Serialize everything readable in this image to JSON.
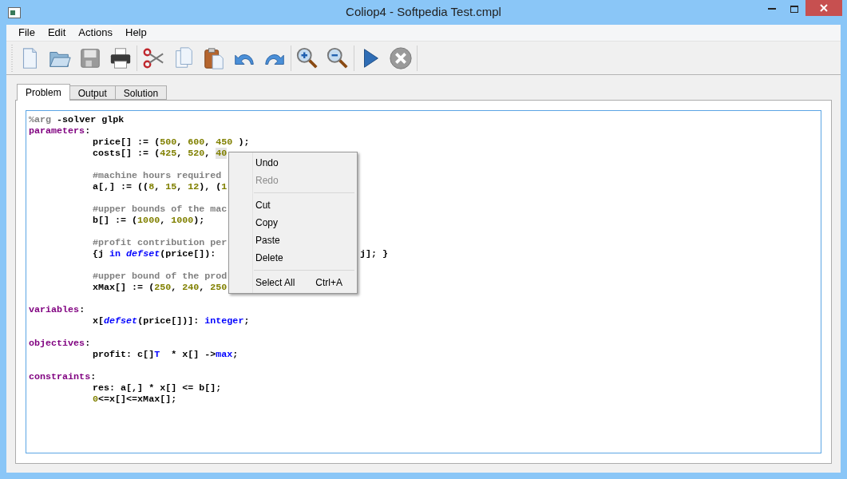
{
  "window": {
    "title": "Coliop4 - Softpedia Test.cmpl"
  },
  "menu_bar": [
    "File",
    "Edit",
    "Actions",
    "Help"
  ],
  "tabs": [
    {
      "label": "Problem",
      "selected": true
    },
    {
      "label": "Output",
      "selected": false
    },
    {
      "label": "Solution",
      "selected": false
    }
  ],
  "editor": {
    "lines": [
      {
        "kind": "code",
        "indented": false,
        "tokens": [
          {
            "text": "%arg",
            "kind": "comment"
          },
          {
            "text": " -solver glpk",
            "kind": "plain"
          }
        ]
      },
      {
        "kind": "code",
        "indented": false,
        "tokens": [
          {
            "text": "parameters",
            "kind": "keyword"
          },
          {
            "text": ":",
            "kind": "plain"
          }
        ]
      },
      {
        "kind": "code",
        "indented": true,
        "tokens": [
          {
            "text": "price[] := (",
            "kind": "plain"
          },
          {
            "text": "500",
            "kind": "number"
          },
          {
            "text": ", ",
            "kind": "plain"
          },
          {
            "text": "600",
            "kind": "number"
          },
          {
            "text": ", ",
            "kind": "plain"
          },
          {
            "text": "450",
            "kind": "number"
          },
          {
            "text": " );",
            "kind": "plain"
          }
        ]
      },
      {
        "kind": "code",
        "indented": true,
        "tokens": [
          {
            "text": "costs[] := (",
            "kind": "plain"
          },
          {
            "text": "425",
            "kind": "number"
          },
          {
            "text": ", ",
            "kind": "plain"
          },
          {
            "text": "520",
            "kind": "number"
          },
          {
            "text": ", ",
            "kind": "plain"
          },
          {
            "text": "40",
            "kind": "highlighted_number"
          }
        ]
      },
      {
        "kind": "blank"
      },
      {
        "kind": "code",
        "indented": true,
        "tokens": [
          {
            "text": "#machine hours required",
            "kind": "comment"
          }
        ]
      },
      {
        "kind": "code",
        "indented": true,
        "tokens": [
          {
            "text": "a[,] := ((",
            "kind": "plain"
          },
          {
            "text": "8",
            "kind": "number"
          },
          {
            "text": ", ",
            "kind": "plain"
          },
          {
            "text": "15",
            "kind": "number"
          },
          {
            "text": ", ",
            "kind": "plain"
          },
          {
            "text": "12",
            "kind": "number"
          },
          {
            "text": "), (",
            "kind": "plain"
          },
          {
            "text": "1",
            "kind": "number"
          }
        ]
      },
      {
        "kind": "blank"
      },
      {
        "kind": "code",
        "indented": true,
        "tokens": [
          {
            "text": "#upper bounds of the mac",
            "kind": "comment"
          }
        ]
      },
      {
        "kind": "code",
        "indented": true,
        "tokens": [
          {
            "text": "b[] := (",
            "kind": "plain"
          },
          {
            "text": "1000",
            "kind": "number"
          },
          {
            "text": ", ",
            "kind": "plain"
          },
          {
            "text": "1000",
            "kind": "number"
          },
          {
            "text": ");",
            "kind": "plain"
          }
        ]
      },
      {
        "kind": "blank"
      },
      {
        "kind": "code",
        "indented": true,
        "tokens": [
          {
            "text": "#profit contribution per",
            "kind": "comment"
          }
        ]
      },
      {
        "kind": "code",
        "indented": true,
        "tokens": [
          {
            "text": "{j ",
            "kind": "plain"
          },
          {
            "text": "in",
            "kind": "builtin"
          },
          {
            "text": " defset",
            "kind": "builtin_italic"
          },
          {
            "text": "(price[]):",
            "kind": "plain"
          }
        ],
        "tail": "j]; }"
      },
      {
        "kind": "blank"
      },
      {
        "kind": "code",
        "indented": true,
        "tokens": [
          {
            "text": "#upper bound of the prod",
            "kind": "comment"
          }
        ]
      },
      {
        "kind": "code",
        "indented": true,
        "tokens": [
          {
            "text": "xMax[] := (",
            "kind": "plain"
          },
          {
            "text": "250",
            "kind": "number"
          },
          {
            "text": ", ",
            "kind": "plain"
          },
          {
            "text": "240",
            "kind": "number"
          },
          {
            "text": ", ",
            "kind": "plain"
          },
          {
            "text": "250",
            "kind": "number"
          }
        ]
      },
      {
        "kind": "blank"
      },
      {
        "kind": "code",
        "indented": false,
        "tokens": [
          {
            "text": "variables",
            "kind": "keyword"
          },
          {
            "text": ":",
            "kind": "plain"
          }
        ]
      },
      {
        "kind": "code",
        "indented": true,
        "tokens": [
          {
            "text": "x[",
            "kind": "plain"
          },
          {
            "text": "defset",
            "kind": "builtin_italic"
          },
          {
            "text": "(price[])]: ",
            "kind": "plain"
          },
          {
            "text": "integer",
            "kind": "builtin"
          },
          {
            "text": ";",
            "kind": "plain"
          }
        ]
      },
      {
        "kind": "blank"
      },
      {
        "kind": "code",
        "indented": false,
        "tokens": [
          {
            "text": "objectives",
            "kind": "keyword"
          },
          {
            "text": ":",
            "kind": "plain"
          }
        ]
      },
      {
        "kind": "code",
        "indented": true,
        "tokens": [
          {
            "text": "profit: c[]",
            "kind": "plain"
          },
          {
            "text": "T",
            "kind": "builtin"
          },
          {
            "text": "  * x[] ->",
            "kind": "plain"
          },
          {
            "text": "max",
            "kind": "builtin"
          },
          {
            "text": ";",
            "kind": "plain"
          }
        ]
      },
      {
        "kind": "blank"
      },
      {
        "kind": "code",
        "indented": false,
        "tokens": [
          {
            "text": "constraints",
            "kind": "keyword"
          },
          {
            "text": ":",
            "kind": "plain"
          }
        ]
      },
      {
        "kind": "code",
        "indented": true,
        "tokens": [
          {
            "text": "res: a[,] * x[] <= b[];",
            "kind": "plain"
          }
        ]
      },
      {
        "kind": "code",
        "indented": true,
        "tokens": [
          {
            "text": "0",
            "kind": "number"
          },
          {
            "text": "<=x[]<=xMax[];",
            "kind": "plain"
          }
        ]
      }
    ]
  },
  "context_menu": [
    {
      "kind": "item",
      "label": "Undo",
      "disabled": false
    },
    {
      "kind": "item",
      "label": "Redo",
      "disabled": true
    },
    {
      "kind": "separator"
    },
    {
      "kind": "item",
      "label": "Cut",
      "disabled": false
    },
    {
      "kind": "item",
      "label": "Copy",
      "disabled": false
    },
    {
      "kind": "item",
      "label": "Paste",
      "disabled": false
    },
    {
      "kind": "item",
      "label": "Delete",
      "disabled": false
    },
    {
      "kind": "separator"
    },
    {
      "kind": "item",
      "label": "Select All",
      "shortcut": "Ctrl+A",
      "disabled": false
    }
  ]
}
